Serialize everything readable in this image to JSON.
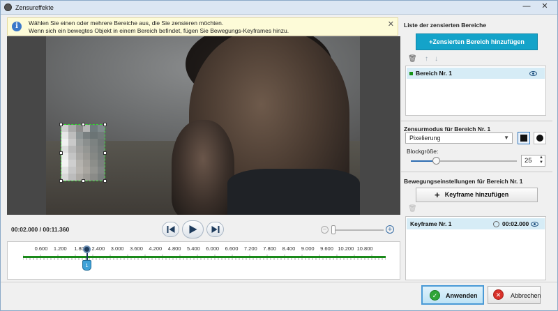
{
  "window": {
    "title": "Zensureffekte",
    "min": "—",
    "close": "✕"
  },
  "info": {
    "line1": "Wählen Sie einen oder mehrere Bereiche aus, die Sie zensieren möchten.",
    "line2": "Wenn sich ein bewegtes Objekt in einem Bereich befindet, fügen Sie Bewegungs-Keyframes hinzu.",
    "icon": "i",
    "close": "✕"
  },
  "player": {
    "time": "00:02.000 / 00:11.360",
    "zoom_out": "−",
    "zoom_in": "+"
  },
  "timeline": {
    "ticks": [
      "0.600",
      "1.200",
      "1.80",
      "2.400",
      "3.000",
      "3.600",
      "4.200",
      "4.800",
      "5.400",
      "6.000",
      "6.600",
      "7.200",
      "7.800",
      "8.400",
      "9.000",
      "9.600",
      "10.200",
      "10.800"
    ],
    "keyframe_marker": "1"
  },
  "areas": {
    "title": "Liste der zensierten Bereiche",
    "add_button": "Zensierten Bereich hinzufügen",
    "add_icon": "+",
    "items": [
      {
        "label": "Bereich Nr. 1"
      }
    ]
  },
  "mode": {
    "title": "Zensurmodus für Bereich Nr. 1",
    "selected": "Pixelierung",
    "block_size_label": "Blockgröße:",
    "block_size": "25"
  },
  "motion": {
    "title": "Bewegungseinstellungen für Bereich Nr. 1",
    "add_keyframe": "Keyframe hinzufügen",
    "add_icon": "+",
    "keyframes": [
      {
        "label": "Keyframe Nr. 1",
        "time": "00:02.000"
      }
    ]
  },
  "buttons": {
    "apply": "Anwenden",
    "cancel": "Abbrechen",
    "apply_icon": "✓",
    "cancel_icon": "✕"
  }
}
